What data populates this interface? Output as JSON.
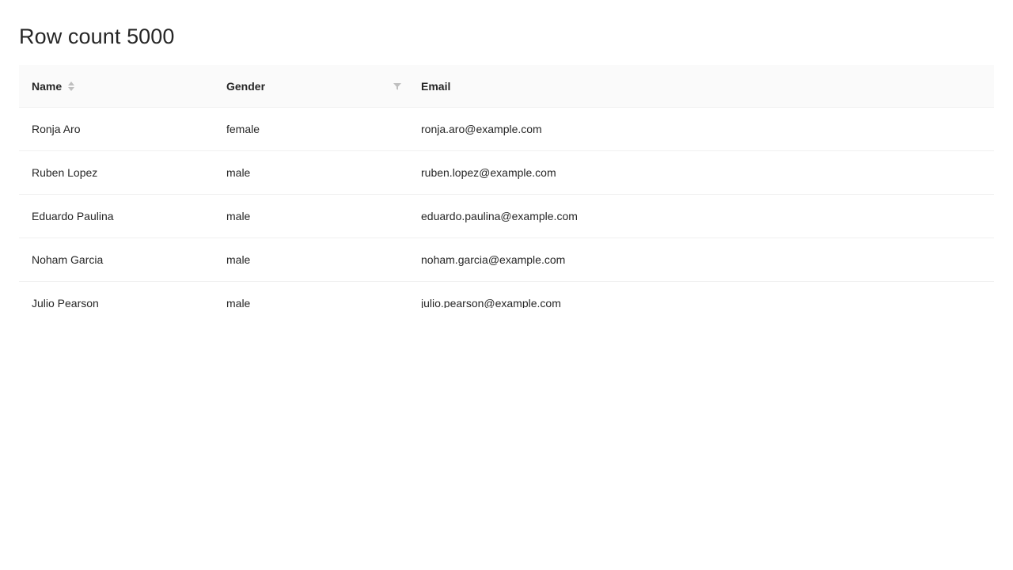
{
  "page": {
    "title": "Row count 5000"
  },
  "table": {
    "columns": [
      {
        "label": "Name",
        "sortable": true
      },
      {
        "label": "Gender",
        "filterable": true
      },
      {
        "label": "Email"
      }
    ],
    "rows": [
      {
        "name": "Ronja Aro",
        "gender": "female",
        "email": "ronja.aro@example.com"
      },
      {
        "name": "Ruben Lopez",
        "gender": "male",
        "email": "ruben.lopez@example.com"
      },
      {
        "name": "Eduardo Paulina",
        "gender": "male",
        "email": "eduardo.paulina@example.com"
      },
      {
        "name": "Noham Garcia",
        "gender": "male",
        "email": "noham.garcia@example.com"
      },
      {
        "name": "Julio Pearson",
        "gender": "male",
        "email": "julio.pearson@example.com"
      }
    ]
  },
  "colors": {
    "header_bg": "#fafafa",
    "row_border": "#f0f0f0",
    "text": "#262626",
    "icon": "#bfbfbf"
  },
  "icons": {
    "sort": "sort-icon",
    "filter": "filter-icon"
  }
}
